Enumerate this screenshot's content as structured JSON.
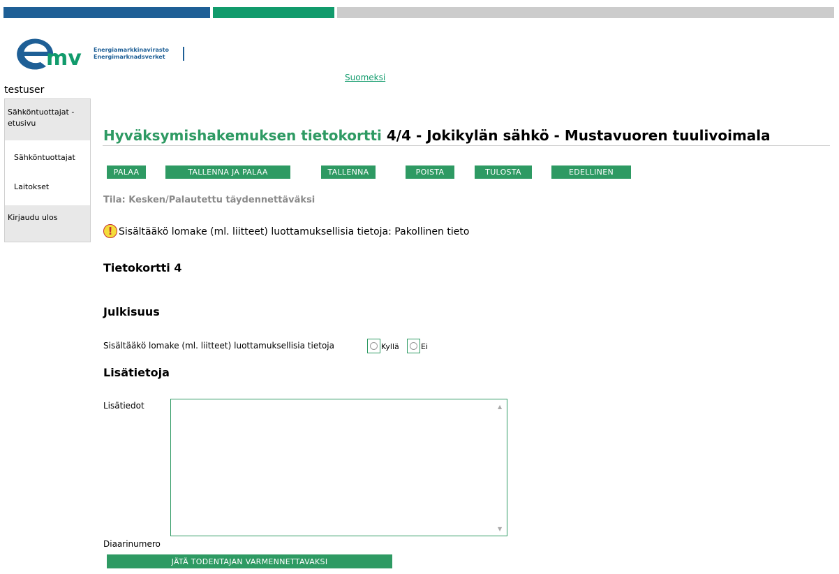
{
  "header": {
    "logo_line1": "Energiamarkkinavirasto",
    "logo_line2": "Energimarknadsverket",
    "language_link": "Suomeksi",
    "colors": {
      "blue": "#1e5f96",
      "green": "#119b6c",
      "gray": "#cccccc"
    }
  },
  "user": {
    "name": "testuser"
  },
  "sidebar": {
    "items": [
      {
        "label": "Sähköntuottajat - etusivu"
      },
      {
        "label": "Sähköntuottajat"
      },
      {
        "label": "Laitokset"
      },
      {
        "label": "Kirjaudu ulos"
      }
    ]
  },
  "page": {
    "title_part1": "Hyväksymishakemuksen tietokortti",
    "title_part2": "4/4 - Jokikylän sähkö - Mustavuoren tuulivoimala",
    "status": "Tila: Kesken/Palautettu täydennettäväksi",
    "warning": "Sisältääkö lomake (ml. liitteet) luottamuksellisia tietoja: Pakollinen tieto",
    "section_card": "Tietokortti 4",
    "section_public": "Julkisuus",
    "question": "Sisältääkö lomake (ml. liitteet) luottamuksellisia tietoja",
    "option_yes": "Kyllä",
    "option_no": "Ei",
    "section_info": "Lisätietoja",
    "info_label": "Lisätiedot",
    "diaari_label": "Diaarinumero",
    "submit_button": "JÄTÄ TODENTAJAN VARMENNETTAVAKSI",
    "accent_color": "#2e9a63"
  },
  "toolbar": {
    "back": "PALAA",
    "save_back": "TALLENNA JA PALAA",
    "save": "TALLENNA",
    "delete": "POISTA",
    "print": "TULOSTA",
    "previous": "EDELLINEN"
  }
}
